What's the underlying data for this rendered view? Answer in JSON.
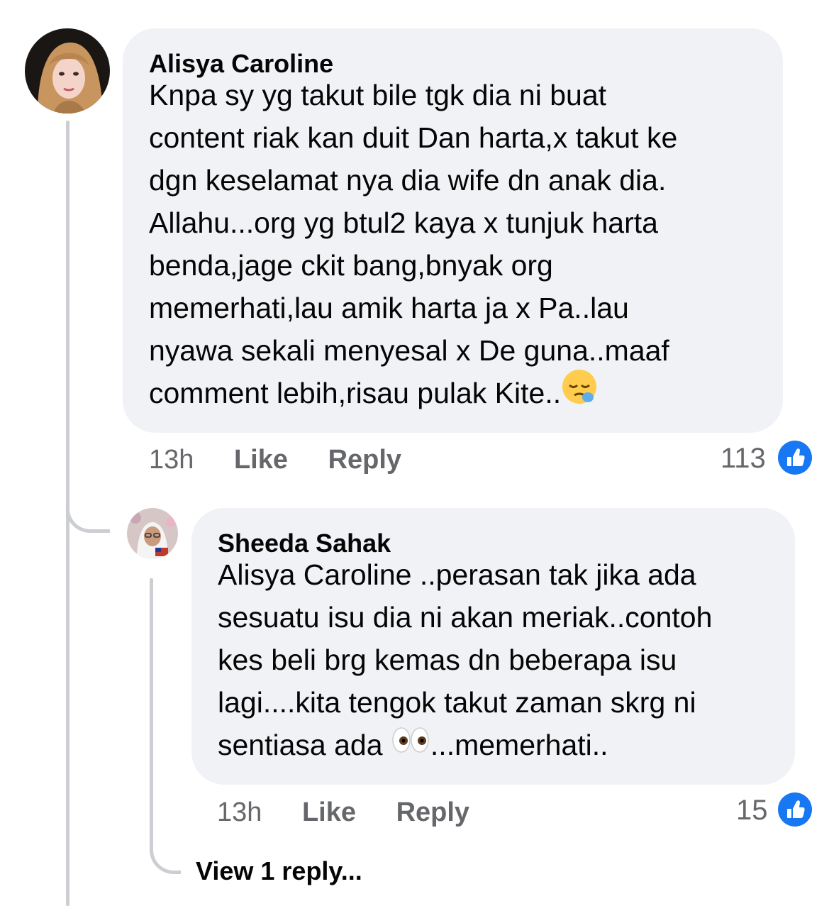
{
  "comment": {
    "author": "Alisya Caroline",
    "text": "Knpa sy yg takut bile tgk dia ni buat\ncontent riak kan duit  Dan harta,x takut ke\ndgn keselamat nya dia wife dn anak dia.\nAllahu...org yg btul2 kaya x tunjuk harta\nbenda,jage ckit bang,bnyak org\nmemerhati,lau amik harta ja x Pa..lau\nnyawa sekali menyesal x De guna..maaf\ncomment lebih,risau pulak Kite..",
    "emoji_icon": "sleepy-face-emoji",
    "time": "13h",
    "like_label": "Like",
    "reply_label": "Reply",
    "reaction_count": "113",
    "reaction_icon": "like-icon"
  },
  "reply": {
    "author": "Sheeda Sahak",
    "text_before": "Alisya Caroline ..perasan tak jika ada\nsesuatu isu dia ni akan meriak..contoh\nkes beli brg kemas dn beberapa isu\nlagi....kita tengok takut zaman skrg ni\nsentiasa ada ",
    "emoji_icon": "eyes-emoji",
    "text_after": "...memerhati..",
    "time": "13h",
    "like_label": "Like",
    "reply_label": "Reply",
    "reaction_count": "15",
    "reaction_icon": "like-icon"
  },
  "view_replies_label": "View 1 reply...",
  "colors": {
    "bubble": "#f0f2f5",
    "meta_text": "#65676b",
    "like_blue": "#1877f2",
    "thread_line": "#ccced2"
  }
}
